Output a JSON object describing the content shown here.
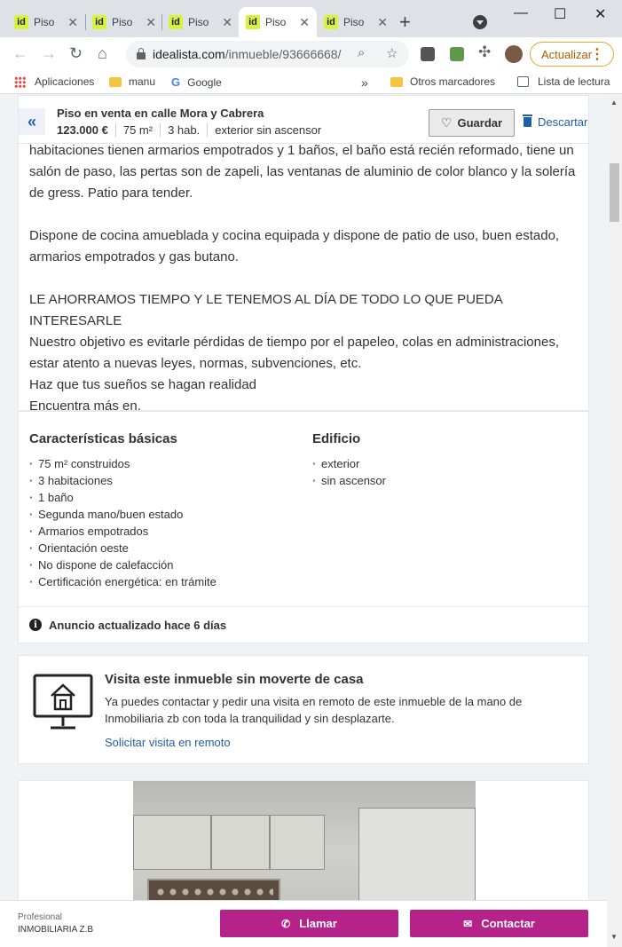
{
  "browser": {
    "tabs": [
      {
        "favicon": "id",
        "title": "Piso"
      },
      {
        "favicon": "id",
        "title": "Piso"
      },
      {
        "favicon": "id",
        "title": "Piso"
      },
      {
        "favicon": "id",
        "title": "Piso"
      },
      {
        "favicon": "id",
        "title": "Piso"
      }
    ],
    "active_tab_index": 3,
    "url_host": "idealista.com",
    "url_path": "/inmueble/93666668/",
    "update_label": "Actualizar",
    "bookmarks": {
      "apps": "Aplicaciones",
      "manu": "manu",
      "google": "Google",
      "others": "Otros marcadores",
      "reading_list": "Lista de lectura"
    }
  },
  "header": {
    "title": "Piso en venta en calle Mora y Cabrera",
    "price": "123.000 €",
    "size": "75 m²",
    "rooms": "3 hab.",
    "floor": "exterior sin ascensor",
    "save_label": "Guardar",
    "discard_label": "Descartar"
  },
  "description": {
    "p1": "habitaciones tienen armarios empotrados y 1 baños, el baño está recién reformado, tiene un salón de paso, las pertas son de zapeli, las ventanas de aluminio de color blanco y la solería de gress. Patio para tender.",
    "p2": "Dispone de cocina amueblada y cocina equipada y dispone de patio de uso, buen estado, armarios empotrados y gas butano.",
    "l1": "LE AHORRAMOS TIEMPO Y LE TENEMOS AL DÍA DE TODO LO QUE PUEDA INTERESARLE",
    "l2": "Nuestro objetivo es evitarle pérdidas de tiempo por el papeleo, colas en administraciones, estar atento a nuevas leyes, normas, subvenciones, etc.",
    "l3": "Haz que tus sueños se hagan realidad",
    "l4": "Encuentra más en."
  },
  "features": {
    "basic_title": "Características básicas",
    "basic": [
      "75 m² construidos",
      "3 habitaciones",
      "1 baño",
      "Segunda mano/buen estado",
      "Armarios empotrados",
      "Orientación oeste",
      "No dispone de calefacción",
      "Certificación energética: en trámite"
    ],
    "building_title": "Edificio",
    "building": [
      "exterior",
      "sin ascensor"
    ]
  },
  "updated": "Anuncio actualizado hace 6 días",
  "remote": {
    "title": "Visita este inmueble sin moverte de casa",
    "text": "Ya puedes contactar y pedir una visita en remoto de este inmueble de la mano de Inmobiliaria zb con toda la tranquilidad y sin desplazarte.",
    "link": "Solicitar visita en remoto"
  },
  "footer": {
    "pro_label": "Profesional",
    "pro_name": "INMOBILIARIA Z.B",
    "call_label": "Llamar",
    "contact_label": "Contactar"
  },
  "colors": {
    "brand_accent": "#b5228a",
    "link": "#1f5ea8",
    "favicon": "#d8f243"
  }
}
